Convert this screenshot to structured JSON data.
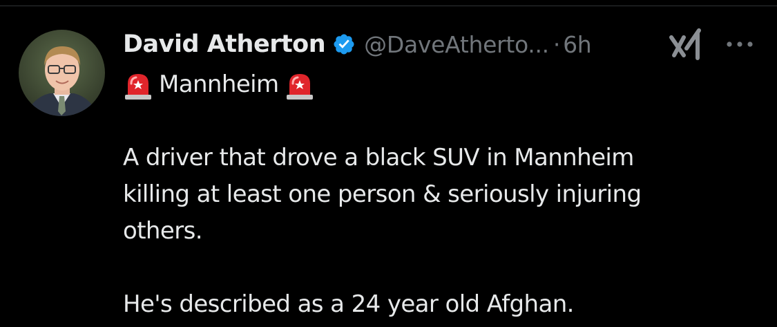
{
  "tweet": {
    "author": {
      "display_name": "David Atherton",
      "verified": true,
      "handle": "@DaveAtherto...",
      "separator": "·",
      "time": "6h"
    },
    "title_emoji": "siren-icon",
    "title_word": "Mannheim",
    "body_lines": [
      "A driver that drove a black SUV in Mannheim",
      "killing at least one person & seriously injuring",
      "others."
    ],
    "closing_line": "He's described as a 24 year old Afghan."
  },
  "colors": {
    "background": "#000000",
    "text_primary": "#e7e9ea",
    "text_secondary": "#71767b",
    "verified_blue": "#1d9bf0",
    "siren_red": "#e0252b"
  },
  "icons": {
    "verified": "verified-badge-icon",
    "grok": "grok-icon",
    "more": "more-options-icon",
    "siren": "siren-icon"
  }
}
